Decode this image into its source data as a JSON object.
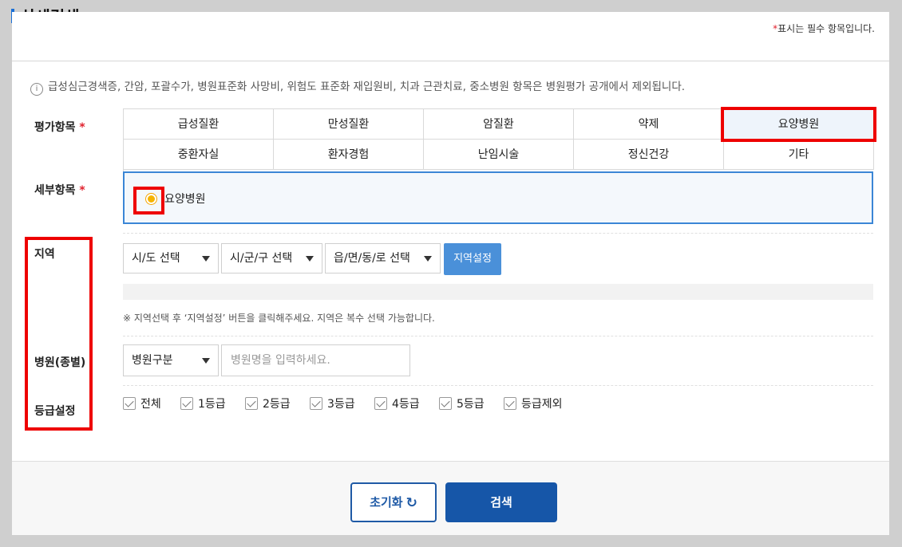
{
  "header": {
    "title": "상세검색",
    "required_note_star": "*",
    "required_note": "표시는 필수 항목입니다."
  },
  "info_text": "급성심근경색증, 간암, 포괄수가, 병원표준화 사망비, 위험도 표준화 재입원비, 치과 근관치료, 중소병원 항목은 병원평가 공개에서 제외됩니다.",
  "labels": {
    "category": "평가항목",
    "detail": "세부항목",
    "region": "지역",
    "hospital": "병원(종별)",
    "grade": "등급설정",
    "star": "*"
  },
  "categories": [
    {
      "label": "급성질환",
      "active": false
    },
    {
      "label": "만성질환",
      "active": false
    },
    {
      "label": "암질환",
      "active": false
    },
    {
      "label": "약제",
      "active": false
    },
    {
      "label": "요양병원",
      "active": true
    },
    {
      "label": "중환자실",
      "active": false
    },
    {
      "label": "환자경험",
      "active": false
    },
    {
      "label": "난임시술",
      "active": false
    },
    {
      "label": "정신건강",
      "active": false
    },
    {
      "label": "기타",
      "active": false
    }
  ],
  "detail": {
    "option_label": "요양병원",
    "selected": true
  },
  "region": {
    "sido": "시/도 선택",
    "sigungu": "시/군/구 선택",
    "eupmyeondong": "읍/면/동/로 선택",
    "set_button": "지역설정",
    "note": "※ 지역선택 후 ‘지역설정’ 버튼을 클릭해주세요. 지역은 복수 선택 가능합니다."
  },
  "hospital": {
    "type_select": "병원구분",
    "name_placeholder": "병원명을 입력하세요."
  },
  "grades": [
    "전체",
    "1등급",
    "2등급",
    "3등급",
    "4등급",
    "5등급",
    "등급제외"
  ],
  "footer": {
    "reset_label": "초기화",
    "search_label": "검색"
  },
  "colors": {
    "accent": "#1a6fd6",
    "highlight": "#e00000",
    "search_button": "#1656a8",
    "region_button": "#4a90d9"
  }
}
